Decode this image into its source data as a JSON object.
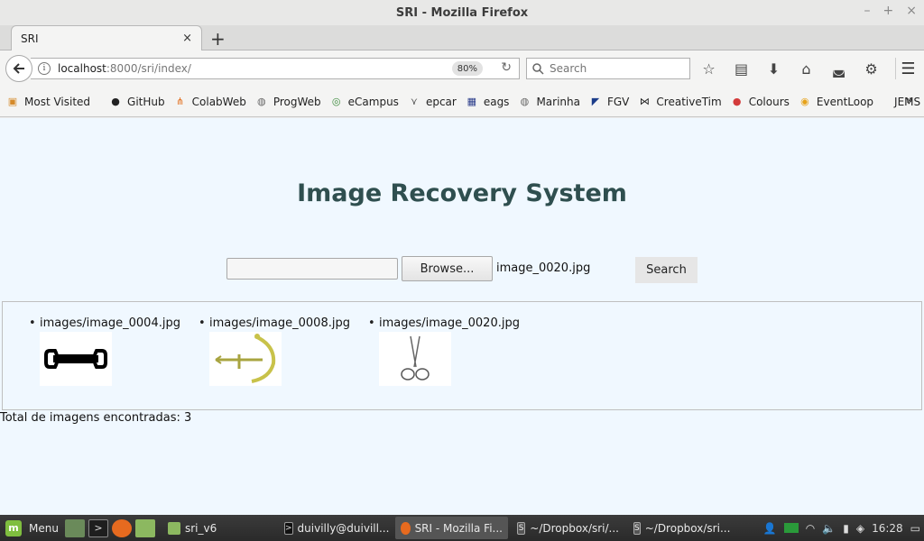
{
  "window": {
    "title": "SRI - Mozilla Firefox",
    "minimize": "–",
    "maximize": "+",
    "close": "×"
  },
  "tab": {
    "label": "SRI",
    "close": "×",
    "new_tab": "+"
  },
  "nav": {
    "url_host": "localhost",
    "url_rest": ":8000/sri/index/",
    "zoom": "80%",
    "search_placeholder": "Search"
  },
  "bookmarks": [
    {
      "label": "Most Visited",
      "icon": "folder-icon",
      "color": "#d58a2a"
    },
    {
      "label": "GitHub",
      "icon": "github-icon",
      "color": "#222222"
    },
    {
      "label": "ColabWeb",
      "icon": "colabweb-icon",
      "color": "#e37222"
    },
    {
      "label": "ProgWeb",
      "icon": "globe-icon",
      "color": "#666666"
    },
    {
      "label": "eCampus",
      "icon": "ecampus-icon",
      "color": "#3b8a3b"
    },
    {
      "label": "epcar",
      "icon": "wings-icon",
      "color": "#555555"
    },
    {
      "label": "eags",
      "icon": "crest-icon",
      "color": "#2a3c8a"
    },
    {
      "label": "Marinha",
      "icon": "globe-icon",
      "color": "#666666"
    },
    {
      "label": "FGV",
      "icon": "fgv-icon",
      "color": "#1c3d8a"
    },
    {
      "label": "CreativeTim",
      "icon": "bowtie-icon",
      "color": "#222222"
    },
    {
      "label": "Colours",
      "icon": "colours-icon",
      "color": "#d33b3b"
    },
    {
      "label": "EventLoop",
      "icon": "eventloop-icon",
      "color": "#e6a21a"
    },
    {
      "label": "JEMS",
      "icon": "",
      "color": ""
    }
  ],
  "bookmarks_more": "»",
  "page": {
    "title": "Image Recovery System",
    "browse_label": "Browse...",
    "selected_file": "image_0020.jpg",
    "search_label": "Search",
    "results": [
      {
        "path": "images/image_0004.jpg",
        "thumb": "wrench"
      },
      {
        "path": "images/image_0008.jpg",
        "thumb": "anchor"
      },
      {
        "path": "images/image_0020.jpg",
        "thumb": "scissors"
      }
    ],
    "total_text": "Total de imagens encontradas: 3"
  },
  "taskbar": {
    "menu_label": "Menu",
    "tasks": [
      {
        "label": "sri_v6",
        "icon": "folder-icon"
      },
      {
        "label": "duivilly@duivill...",
        "icon": "terminal-icon"
      },
      {
        "label": "SRI - Mozilla Fi...",
        "icon": "firefox-icon"
      },
      {
        "label": "~/Dropbox/sri/...",
        "icon": "sublime-icon"
      },
      {
        "label": "~/Dropbox/sri...",
        "icon": "sublime-icon"
      }
    ],
    "clock": "16:28"
  }
}
